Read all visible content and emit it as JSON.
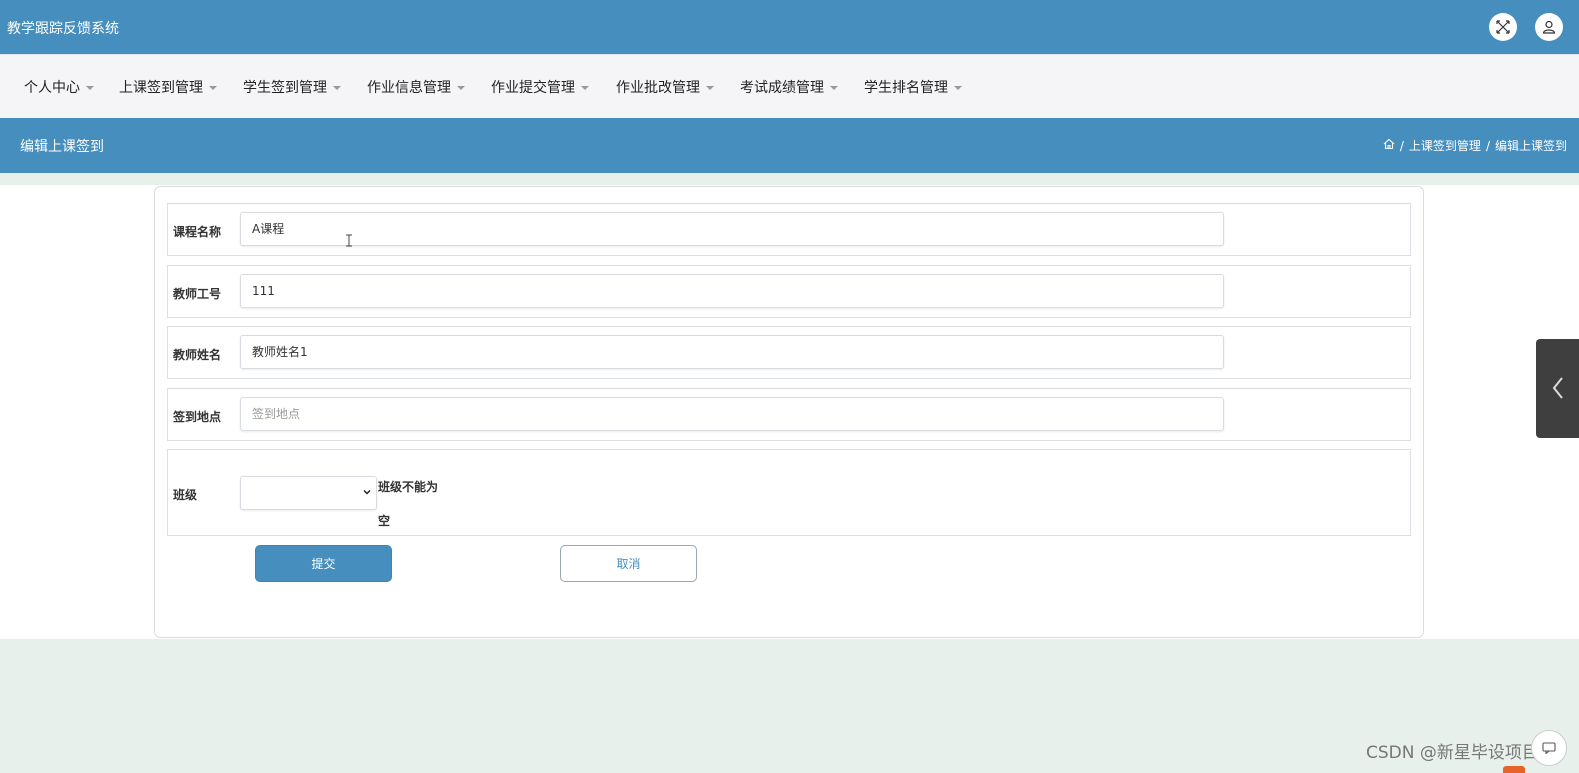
{
  "app": {
    "title": "教学跟踪反馈系统"
  },
  "topbar": {
    "icons": [
      "fullscreen-icon",
      "user-icon"
    ]
  },
  "menu": [
    {
      "label": "个人中心"
    },
    {
      "label": "上课签到管理"
    },
    {
      "label": "学生签到管理"
    },
    {
      "label": "作业信息管理"
    },
    {
      "label": "作业提交管理"
    },
    {
      "label": "作业批改管理"
    },
    {
      "label": "考试成绩管理"
    },
    {
      "label": "学生排名管理"
    }
  ],
  "page": {
    "title": "编辑上课签到",
    "breadcrumb": [
      "上课签到管理",
      "编辑上课签到"
    ],
    "breadcrumb_sep": "/"
  },
  "form": {
    "course_name": {
      "label": "课程名称",
      "value": "A课程"
    },
    "teacher_id": {
      "label": "教师工号",
      "value": "111"
    },
    "teacher_name": {
      "label": "教师姓名",
      "value": "教师姓名1"
    },
    "location": {
      "label": "签到地点",
      "placeholder": "签到地点",
      "value": ""
    },
    "class": {
      "label": "班级",
      "value": "",
      "error": "班级不能为空"
    },
    "submit_label": "提交",
    "cancel_label": "取消"
  },
  "watermark": "CSDN @新星毕设项目",
  "colors": {
    "primary": "#458ebe",
    "background": "#e8f0ec",
    "menubar": "#f5f4f7"
  }
}
